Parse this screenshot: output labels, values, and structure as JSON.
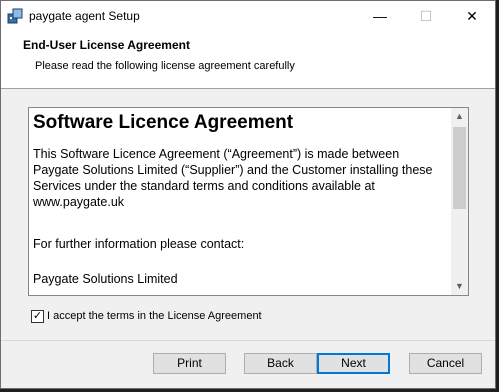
{
  "window": {
    "title": "paygate agent Setup"
  },
  "titlebar_buttons": {
    "minimize": "—",
    "maximize": "☐",
    "close": "✕"
  },
  "header": {
    "title": "End-User License Agreement",
    "subtitle": "Please read the following license agreement carefully"
  },
  "license": {
    "heading": "Software Licence Agreement",
    "paragraph1": "This Software Licence Agreement (“Agreement”) is made between Paygate Solutions Limited (“Supplier”) and the Customer installing these Services under the standard terms and conditions available at www.paygate.uk",
    "paragraph2": "For further information please contact:",
    "paragraph3": "Paygate Solutions Limited"
  },
  "accept": {
    "label": "I accept the terms in the License Agreement",
    "checked_mark": "✓"
  },
  "buttons": {
    "print": "Print",
    "back": "Back",
    "next": "Next",
    "cancel": "Cancel"
  },
  "scroll": {
    "up": "▲",
    "down": "▼"
  }
}
